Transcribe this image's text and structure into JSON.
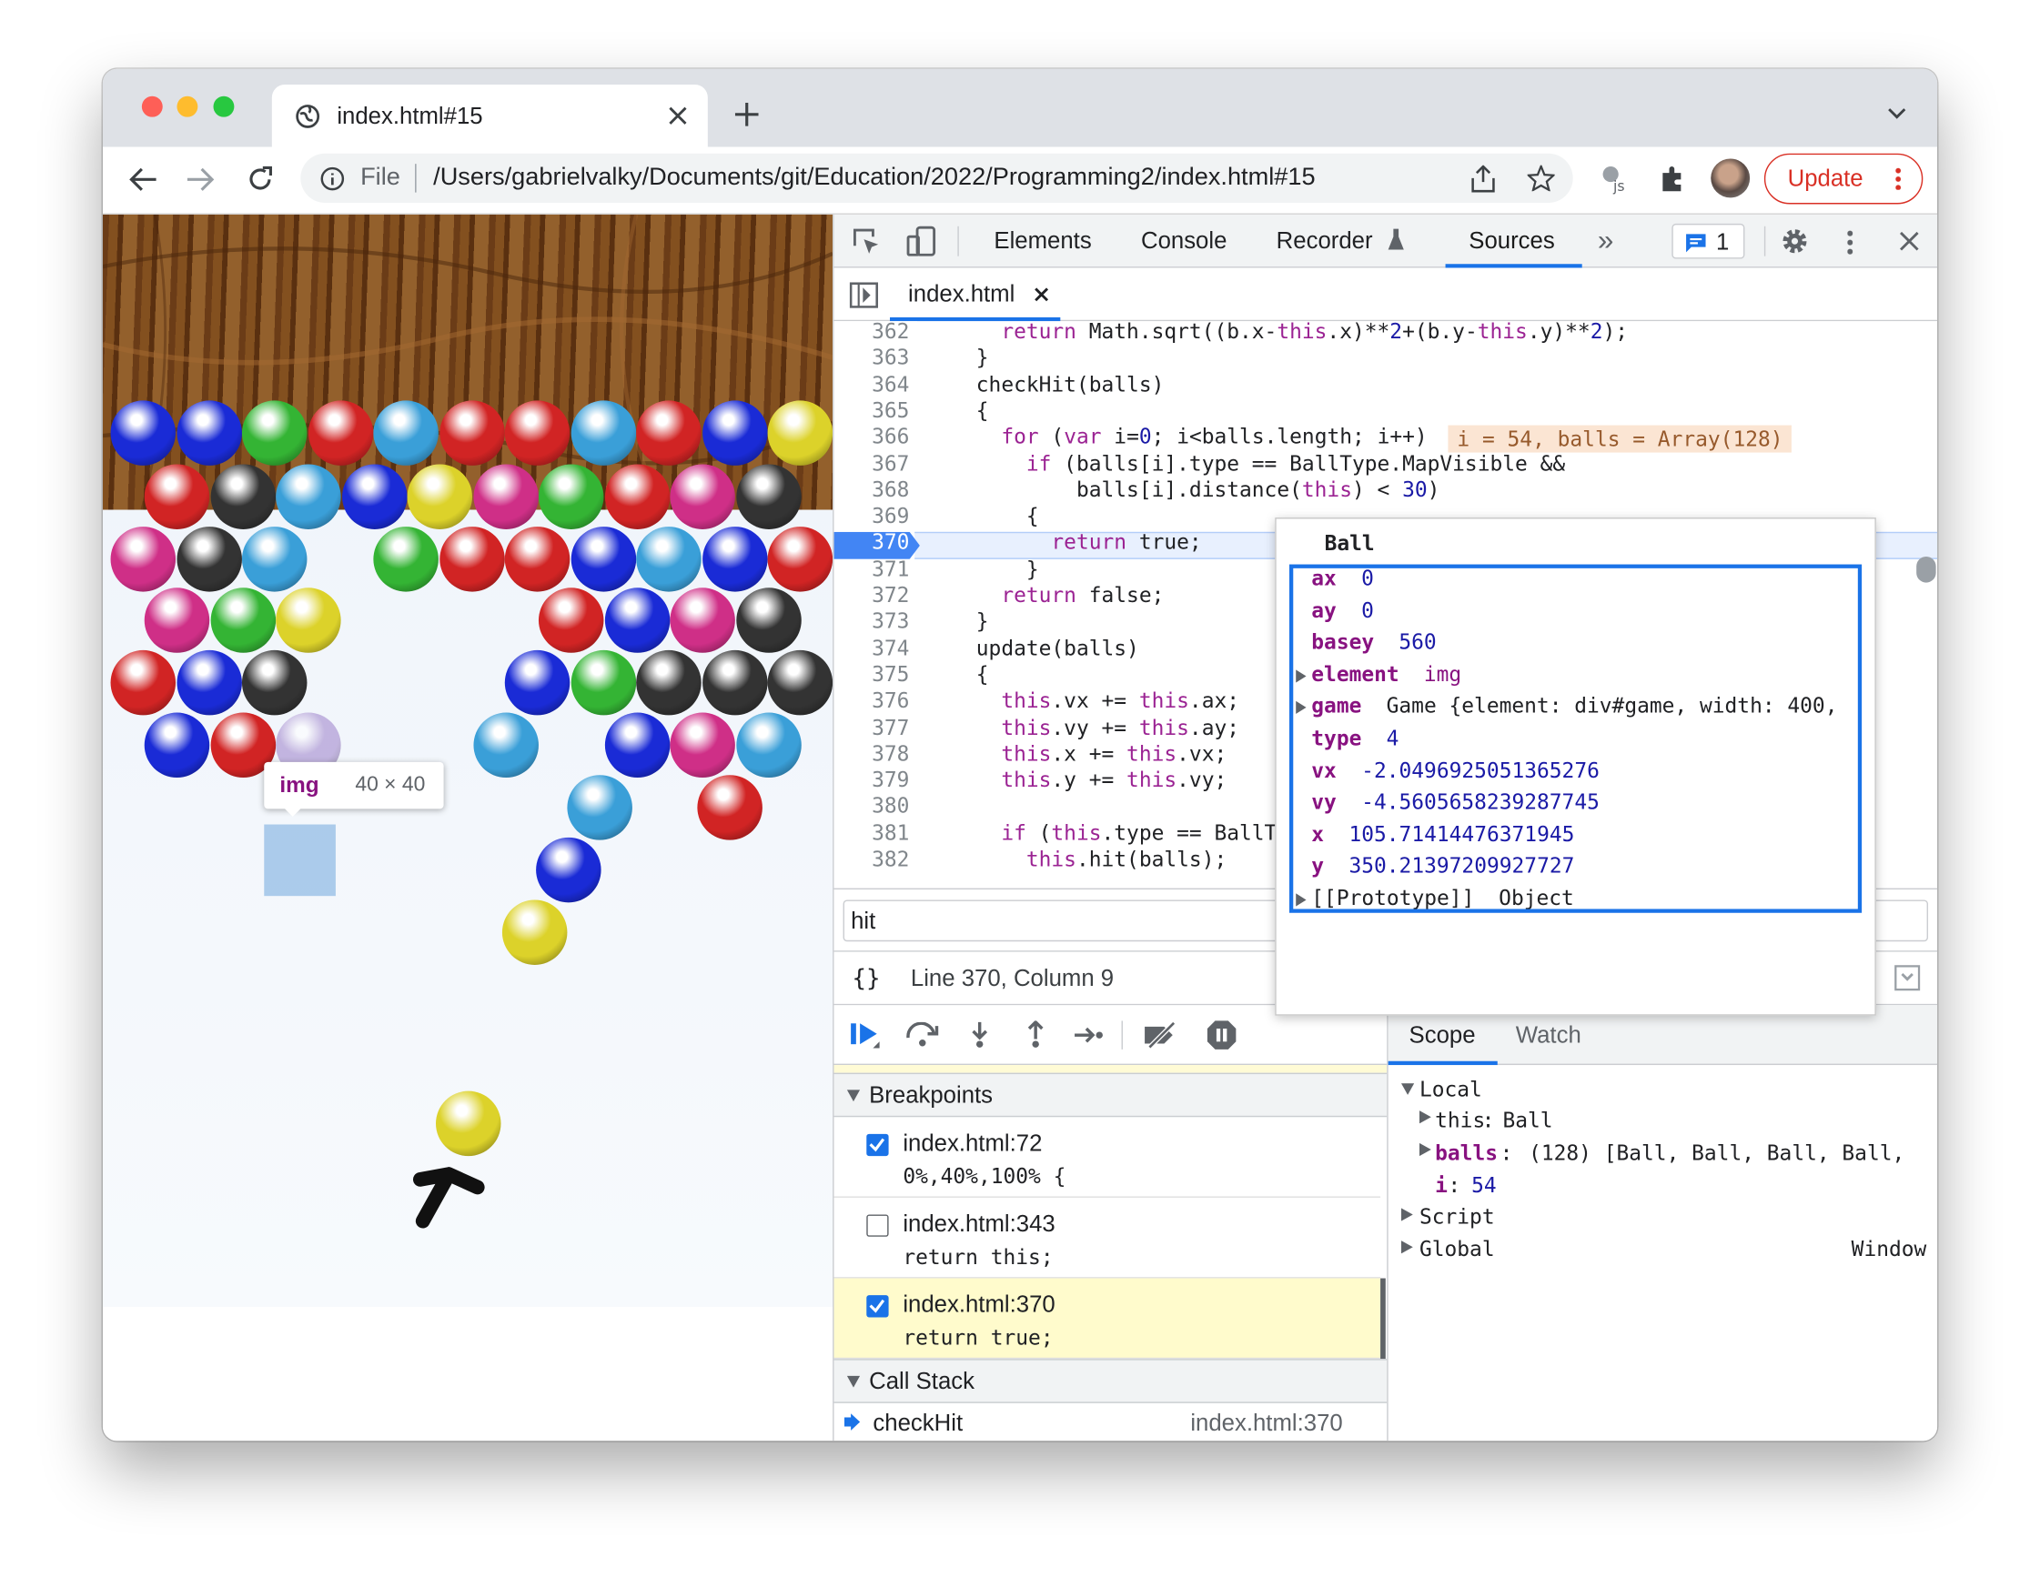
{
  "browser": {
    "tab_title": "index.html#15",
    "address_scheme": "File",
    "address_url": "/Users/gabrielvalky/Documents/git/Education/2022/Programming2/index.html#15",
    "update_label": "Update"
  },
  "page": {
    "inspect_tooltip_tag": "img",
    "inspect_tooltip_size": "40 × 40",
    "ball_colors": {
      "blue": "#1a2bd6",
      "red": "#d12424",
      "green": "#34b434",
      "cyan": "#3a9fd8",
      "yellow": "#dcd22a",
      "pink": "#cf2f87",
      "black": "#333333",
      "purple": "#9b7fc9"
    }
  },
  "devtools": {
    "tabs": [
      "Elements",
      "Console",
      "Recorder",
      "Sources"
    ],
    "more_tabs": "»",
    "issues_count": "1",
    "file_tab": "index.html",
    "code_lines": [
      {
        "n": "362",
        "text": "    return Math.sqrt((b.x-this.x)**2+(b.y-this.y)**2);"
      },
      {
        "n": "363",
        "text": "  }"
      },
      {
        "n": "364",
        "text": "  checkHit(balls)"
      },
      {
        "n": "365",
        "text": "  {"
      },
      {
        "n": "366",
        "text": "    for (var i=0; i<balls.length; i++)"
      },
      {
        "n": "367",
        "text": "      if (balls[i].type == BallType.MapVisible &&"
      },
      {
        "n": "368",
        "text": "          balls[i].distance(this) < 30)"
      },
      {
        "n": "369",
        "text": "      {"
      },
      {
        "n": "370",
        "text": "        return true;"
      },
      {
        "n": "371",
        "text": "      }"
      },
      {
        "n": "372",
        "text": "    return false;"
      },
      {
        "n": "373",
        "text": "  }"
      },
      {
        "n": "374",
        "text": "  update(balls)"
      },
      {
        "n": "375",
        "text": "  {"
      },
      {
        "n": "376",
        "text": "    this.vx += this.ax;"
      },
      {
        "n": "377",
        "text": "    this.vy += this.ay;"
      },
      {
        "n": "378",
        "text": "    this.x += this.vx;"
      },
      {
        "n": "379",
        "text": "    this.y += this.vy;"
      },
      {
        "n": "380",
        "text": ""
      },
      {
        "n": "381",
        "text": "    if (this.type == BallTy"
      },
      {
        "n": "382",
        "text": "      this.hit(balls);"
      }
    ],
    "inline_values": "i = 54, balls = Array(128)",
    "popover": {
      "title": "Ball",
      "props": [
        {
          "key": "ax",
          "value": "0",
          "expandable": false
        },
        {
          "key": "ay",
          "value": "0",
          "expandable": false
        },
        {
          "key": "basey",
          "value": "560",
          "expandable": false
        },
        {
          "key": "element",
          "value": "img",
          "expandable": true
        },
        {
          "key": "game",
          "value": "Game {element: div#game, width: 400,",
          "expandable": true
        },
        {
          "key": "type",
          "value": "4",
          "expandable": false
        },
        {
          "key": "vx",
          "value": "-2.0496925051365276",
          "expandable": false
        },
        {
          "key": "vy",
          "value": "-4.5605658239287745",
          "expandable": false
        },
        {
          "key": "x",
          "value": "105.71414476371945",
          "expandable": false
        },
        {
          "key": "y",
          "value": "350.21397209927727",
          "expandable": false
        },
        {
          "key": "[[Prototype]]",
          "value": "Object",
          "expandable": true
        }
      ]
    },
    "search_value": "hit",
    "status_braces": "{}",
    "status_text": "Line 370, Column 9",
    "breakpoints_header": "Breakpoints",
    "breakpoints": [
      {
        "file": "index.html:72",
        "code": "0%,40%,100% {",
        "checked": true
      },
      {
        "file": "index.html:343",
        "code": "return this;",
        "checked": false
      },
      {
        "file": "index.html:370",
        "code": "return true;",
        "checked": true
      }
    ],
    "callstack_header": "Call Stack",
    "callstack": [
      {
        "fn": "checkHit",
        "loc": "index.html:370"
      }
    ],
    "scope_tabs": [
      "Scope",
      "Watch"
    ],
    "scope": {
      "local": "Local",
      "this_key": "this",
      "this_val": "Ball",
      "balls_key": "balls",
      "balls_val": "(128) [Ball, Ball, Ball, Ball,",
      "i_key": "i",
      "i_val": "54",
      "script": "Script",
      "global": "Global",
      "global_val": "Window"
    }
  }
}
